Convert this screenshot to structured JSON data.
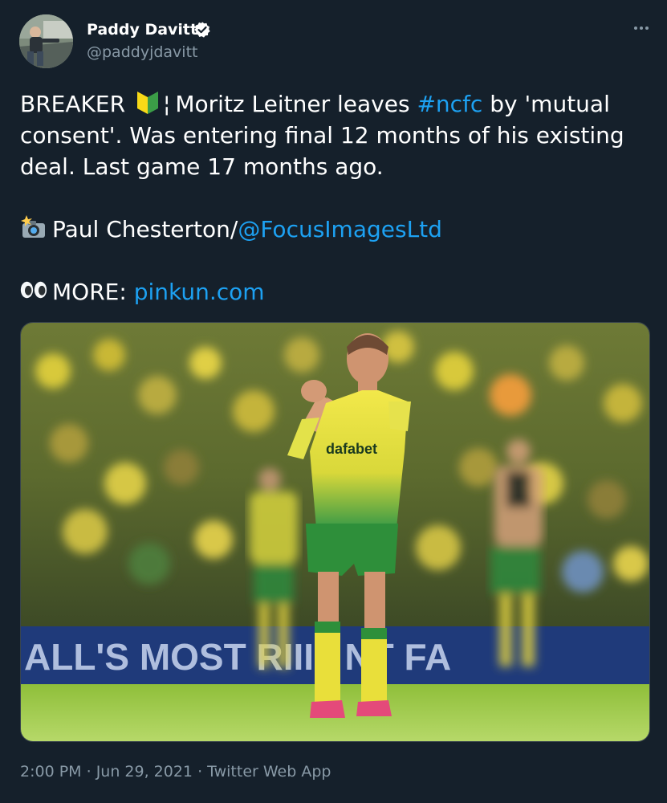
{
  "author": {
    "name": "Paddy Davitt",
    "handle": "@paddyjdavitt",
    "verified": true,
    "avatar_icon": "user-avatar"
  },
  "more_icon": "more-options-icon",
  "tweet": {
    "line1_pre": "BREAKER",
    "line1_bar": "¦",
    "line1_mid": "Moritz Leitner leaves",
    "hashtag": "#ncfc",
    "line1_post": "by 'mutual",
    "line2": "consent'. Was entering final 12 months of his existing",
    "line3": "deal. Last game 17 months ago.",
    "credit_prefix": "Paul Chesterton/",
    "credit_mention": "@FocusImagesLtd",
    "more_label": "MORE:",
    "more_link": "pinkun.com",
    "emojis": {
      "beginner": "japanese-beginner-symbol-icon",
      "camera": "camera-flash-icon",
      "eyes": "eyes-icon"
    }
  },
  "media": {
    "description_icon": "photo-footballer-applauding",
    "shirt_sponsor": "dafabet",
    "stand_banner": "ALL'S MOST  RIII  I  NT FA"
  },
  "meta": {
    "time": "2:00 PM",
    "separator1": " · ",
    "date": "Jun 29, 2021",
    "separator2": " · ",
    "source": "Twitter Web App"
  },
  "colors": {
    "background": "#15202b",
    "text": "#ffffff",
    "secondary": "#8899a6",
    "link": "#1da1f2",
    "border": "#38444d"
  }
}
